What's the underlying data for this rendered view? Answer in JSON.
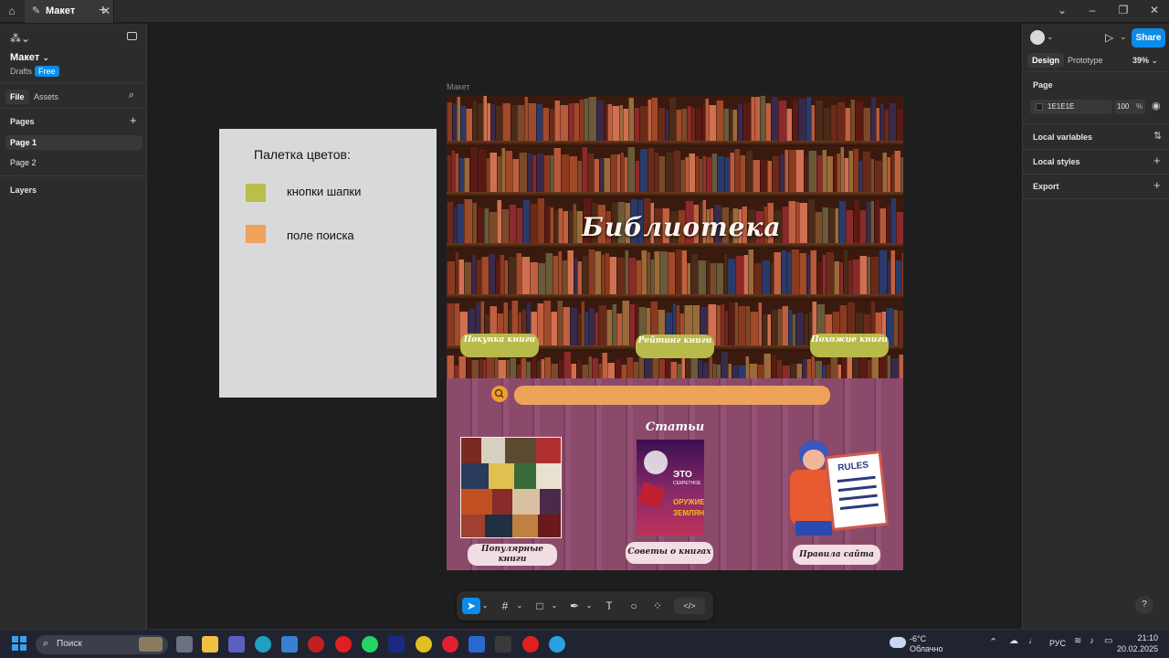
{
  "titlebar": {
    "tab_title": "Макет"
  },
  "left_panel": {
    "file_name": "Макет",
    "drafts_label": "Drafts",
    "plan_badge": "Free",
    "tabs": [
      "File",
      "Assets"
    ],
    "pages_heading": "Pages",
    "pages": [
      "Page 1",
      "Page 2"
    ],
    "layers_heading": "Layers"
  },
  "palette_card": {
    "title": "Палетка цветов:",
    "swatches": [
      {
        "label": "кнопки шапки",
        "color": "#b8c04a"
      },
      {
        "label": "поле поиска",
        "color": "#eea35a"
      }
    ]
  },
  "frame": {
    "label": "Макет",
    "hero_title": "Библиотека",
    "header_buttons": [
      "Покупка книги",
      "Рейтинг книги",
      "Похожие книги"
    ],
    "articles_title": "Статьи",
    "card_labels": [
      "Популярные книги",
      "Советы о книгах",
      "Правила сайта"
    ],
    "rules_word": "RULES",
    "book_cover_text": [
      "ЭТО",
      "СЕКРЕТНОЕ",
      "ОРУЖИЕ",
      "ЗЕМЛЯН"
    ]
  },
  "right_panel": {
    "share_label": "Share",
    "tabs": [
      "Design",
      "Prototype"
    ],
    "zoom": "39%",
    "page_heading": "Page",
    "page_color": "1E1E1E",
    "page_opacity": "100",
    "percent": "%",
    "sections": [
      "Local variables",
      "Local styles",
      "Export"
    ]
  },
  "toolbar": {
    "code_icon": "code-icon"
  },
  "taskbar": {
    "search_placeholder": "Поиск",
    "temperature": "-6°C",
    "weather": "Облачно",
    "language": "РУС",
    "time": "21:10",
    "date": "20.02.2025"
  },
  "colors": {
    "accent": "#0c8ce9",
    "header_button": "#b8ba4a",
    "search": "#eea35a",
    "lower_bg": "#8b4a6a"
  }
}
